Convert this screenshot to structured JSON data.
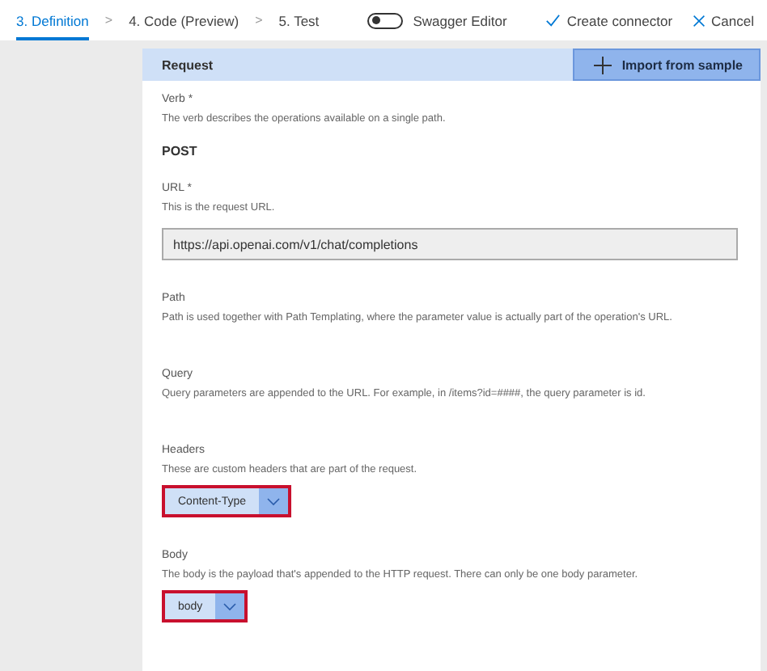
{
  "steps": [
    {
      "label": "3. Definition",
      "selected": true
    },
    {
      "label": "4. Code (Preview)",
      "selected": false
    },
    {
      "label": "5. Test",
      "selected": false
    }
  ],
  "step_separator": ">",
  "swagger_toggle": {
    "label": "Swagger Editor",
    "on": false
  },
  "actions": [
    {
      "label": "Create connector",
      "kind": "check"
    },
    {
      "label": "Cancel",
      "kind": "close"
    }
  ],
  "section": {
    "title": "Request",
    "import_button": "Import from sample"
  },
  "fields": [
    {
      "kind": "static",
      "label": "Verb *",
      "description": "The verb describes the operations available on a single path.",
      "value": "POST"
    },
    {
      "kind": "input",
      "label": "URL *",
      "description": "This is the request URL.",
      "value": "https://api.openai.com/v1/chat/completions"
    },
    {
      "kind": "none",
      "label": "Path",
      "description": "Path is used together with Path Templating, where the parameter value is actually part of the operation's URL."
    },
    {
      "kind": "none",
      "label": "Query",
      "description": "Query parameters are appended to the URL. For example, in /items?id=####, the query parameter is id."
    },
    {
      "kind": "chip",
      "label": "Headers",
      "description": "These are custom headers that are part of the request.",
      "value": "Content-Type",
      "highlighted": true
    },
    {
      "kind": "chip",
      "label": "Body",
      "description": "The body is the payload that's appended to the HTTP request. There can only be one body parameter.",
      "value": "body",
      "highlighted": true
    }
  ]
}
